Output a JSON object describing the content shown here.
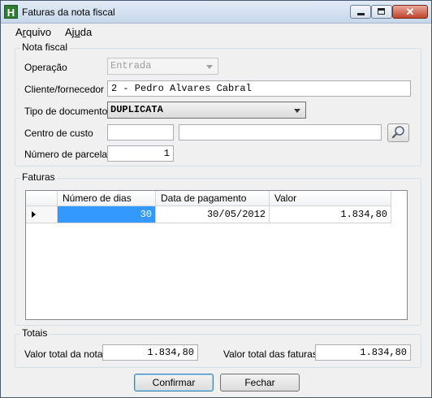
{
  "window": {
    "title": "Faturas da nota fiscal",
    "app_icon_glyph": "H",
    "close_glyph": "✕"
  },
  "menu": [
    {
      "label": "Arquivo",
      "mnemonic": "r"
    },
    {
      "label": "Ajuda",
      "mnemonic": "u"
    }
  ],
  "nota_fiscal": {
    "legend": "Nota fiscal",
    "operacao": {
      "label": "Operação",
      "value": "Entrada"
    },
    "cliente": {
      "label": "Cliente/fornecedor",
      "value": "2 - Pedro Alvares Cabral"
    },
    "tipo_documento": {
      "label": "Tipo de documento",
      "value": "DUPLICATA"
    },
    "centro_custo": {
      "label": "Centro de custo",
      "code": "",
      "description": ""
    },
    "parcelas": {
      "label": "Número de parcelas",
      "value": "1"
    }
  },
  "faturas": {
    "legend": "Faturas",
    "columns": [
      "Número de dias",
      "Data de pagamento",
      "Valor"
    ],
    "rows": [
      {
        "dias": "30",
        "data": "30/05/2012",
        "valor": "1.834,80"
      }
    ]
  },
  "totais": {
    "legend": "Totais",
    "nota": {
      "label": "Valor total da nota",
      "value": "1.834,80"
    },
    "faturas": {
      "label": "Valor total das faturas",
      "value": "1.834,80"
    }
  },
  "buttons": {
    "confirmar": {
      "label": "Confirmar"
    },
    "fechar": {
      "label": "Fechar"
    }
  },
  "icons": {
    "search": "magnifier-icon"
  }
}
